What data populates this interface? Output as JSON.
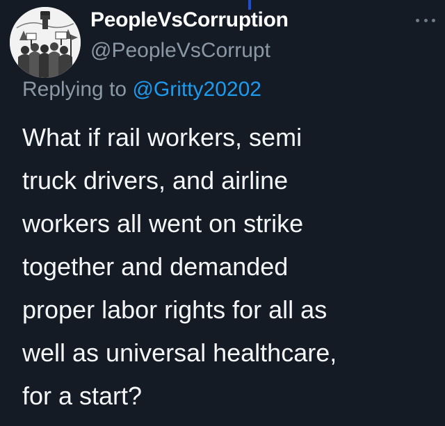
{
  "author": {
    "display_name": "PeopleVsCorruption",
    "handle": "@PeopleVsCorrupt",
    "avatar_icon": "protest-crowd-illustration"
  },
  "reply": {
    "prefix": "Replying to",
    "username": "@Gritty20202"
  },
  "tweet": {
    "lines": [
      "What if rail workers, semi",
      "truck drivers, and airline",
      "workers all went on strike",
      "together and demanded",
      "proper labor rights for all as",
      "well as universal healthcare,",
      "for a start?"
    ]
  },
  "icons": {
    "more": "more-options-icon"
  },
  "colors": {
    "background": "#141b25",
    "name": "#ffffff",
    "muted": "#8b98a5",
    "link": "#1d9bf0"
  }
}
